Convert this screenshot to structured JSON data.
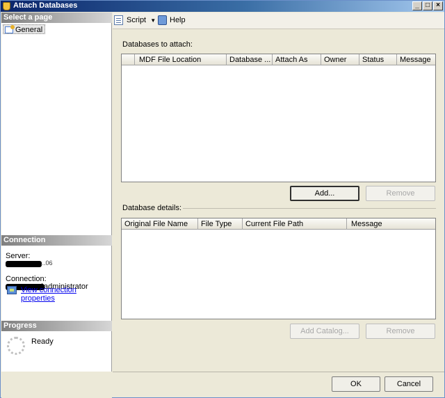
{
  "window": {
    "title": "Attach Databases"
  },
  "left_panel": {
    "select_page_header": "Select a page",
    "pages": [
      "General"
    ],
    "connection_header": "Connection",
    "server_label": "Server:",
    "server_value_suffix": "...06",
    "connection_label": "Connection:",
    "connection_value_suffix": "\\administrator",
    "view_connection_properties": "View connection properties",
    "progress_header": "Progress",
    "progress_status": "Ready"
  },
  "toolbar": {
    "script_label": "Script",
    "help_label": "Help"
  },
  "databases_to_attach": {
    "label": "Databases to attach:",
    "columns": [
      "MDF File Location",
      "Database ...",
      "Attach As",
      "Owner",
      "Status",
      "Message"
    ],
    "add_button": "Add...",
    "remove_button": "Remove"
  },
  "database_details": {
    "label": "Database details:",
    "columns": [
      "Original File Name",
      "File Type",
      "Current File Path",
      "Message"
    ],
    "add_catalog_button": "Add Catalog...",
    "remove_button": "Remove"
  },
  "footer": {
    "ok_button": "OK",
    "cancel_button": "Cancel"
  }
}
